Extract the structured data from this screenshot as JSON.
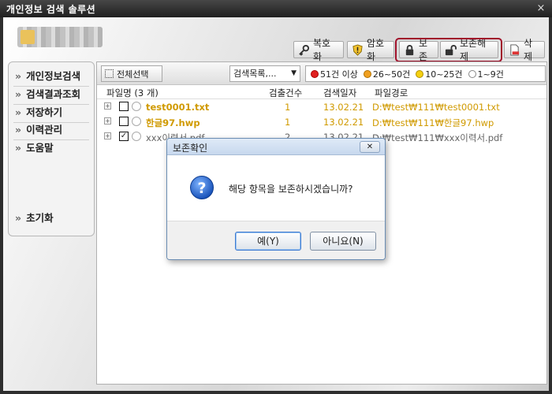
{
  "window": {
    "title": "개인정보 검색 솔루션",
    "close_glyph": "×"
  },
  "toolbar": {
    "decrypt": "복호화",
    "encrypt": "암호화",
    "preserve": "보존",
    "unpreserve": "보존해제",
    "delete": "삭제",
    "highlight_color": "#a0102a"
  },
  "sidebar": {
    "items": [
      "개인정보검색",
      "검색결과조회",
      "저장하기",
      "이력관리",
      "도움말"
    ],
    "reset": "초기화"
  },
  "main": {
    "select_all": "전체선택",
    "list_combo": "검색목록,...",
    "legend": [
      {
        "label": "51건 이상",
        "color": "#e02020"
      },
      {
        "label": "26~50건",
        "color": "#f0a020"
      },
      {
        "label": "10~25건",
        "color": "#f5d010"
      },
      {
        "label": "1~9건",
        "color": "#ffffff"
      }
    ],
    "columns": {
      "name": "파일명 (3 개)",
      "count": "검출건수",
      "date": "검색일자",
      "path": "파일경로"
    },
    "rows": [
      {
        "name": "test0001.txt",
        "count": "1",
        "date": "13.02.21",
        "path": "D:₩test₩111₩test0001.txt",
        "checked": false
      },
      {
        "name": "한글97.hwp",
        "count": "1",
        "date": "13.02.21",
        "path": "D:₩test₩111₩한글97.hwp",
        "checked": false
      },
      {
        "name": "xxx이력서.pdf",
        "count": "2",
        "date": "13.02.21",
        "path": "D:₩test₩111₩xxx이력서.pdf",
        "checked": true
      }
    ]
  },
  "dialog": {
    "title": "보존확인",
    "close_glyph": "✕",
    "message": "해당 항목을 보존하시겠습니까?",
    "yes": "예(Y)",
    "no": "아니요(N)"
  }
}
